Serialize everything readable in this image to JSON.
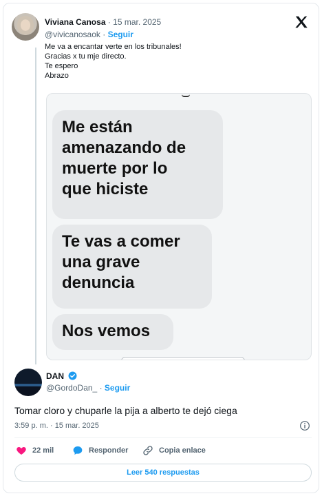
{
  "parent_tweet": {
    "author_name": "Viviana Canosa",
    "date": "· 15 mar. 2025",
    "handle": "@vivicanosaok",
    "follow_label": "Seguir",
    "text_lines": [
      "Me va a encantar verte en los tribunales!",
      "Gracias x tu mje directo.",
      "Te espero",
      "Abrazo"
    ],
    "embedded_messages": {
      "bubble1": [
        "Me están",
        "amenazando de",
        "muerte por lo",
        "que hiciste"
      ],
      "bubble2": [
        "Te vas a comer",
        "una grave",
        "denuncia"
      ],
      "bubble3": [
        "Nos vemos"
      ]
    }
  },
  "main_tweet": {
    "author_name": "DAN",
    "handle": "@GordoDan_",
    "follow_label": "Seguir",
    "text": "Tomar cloro y chuparle la pija a alberto te dejó ciega",
    "timestamp": "3:59 p. m. · 15 mar. 2025",
    "likes": "22 mil",
    "reply_label": "Responder",
    "copy_link_label": "Copia enlace",
    "read_replies_label": "Leer 540 respuestas"
  },
  "colors": {
    "accent": "#1d9bf0",
    "like": "#f91880",
    "secondary_text": "#536471"
  },
  "icons": [
    "x-logo-icon",
    "verified-badge-icon",
    "info-icon",
    "heart-icon",
    "reply-bubble-icon",
    "link-icon"
  ]
}
